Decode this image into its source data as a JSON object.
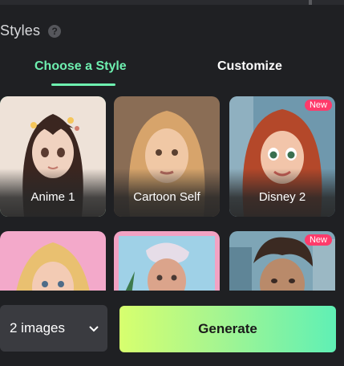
{
  "header": {
    "title": "Styles",
    "help_icon": "?"
  },
  "tabs": [
    {
      "label": "Choose a Style",
      "active": true
    },
    {
      "label": "Customize",
      "active": false
    }
  ],
  "styles": [
    {
      "label": "Anime 1",
      "selected": true,
      "badge": "",
      "palette": [
        "#f2e6df",
        "#3b2620",
        "#e9c8b5"
      ]
    },
    {
      "label": "Cartoon Self",
      "selected": false,
      "badge": "",
      "palette": [
        "#b58a64",
        "#d9a46c",
        "#f0c9a6"
      ]
    },
    {
      "label": "Disney 2",
      "selected": false,
      "badge": "New",
      "palette": [
        "#6b9bb3",
        "#b24a2b",
        "#f1c3a8"
      ]
    },
    {
      "label": "",
      "selected": false,
      "badge": "",
      "palette": [
        "#f0a8c8",
        "#e9c070",
        "#f1c9b0"
      ]
    },
    {
      "label": "",
      "selected": false,
      "badge": "",
      "palette": [
        "#f3a3c3",
        "#e6dde8",
        "#d9a08a"
      ]
    },
    {
      "label": "",
      "selected": false,
      "badge": "New",
      "palette": [
        "#6f97a8",
        "#3b2a22",
        "#b98b6c"
      ]
    }
  ],
  "controls": {
    "image_count": "2 images",
    "generate_label": "Generate"
  },
  "colors": {
    "accent": "#6ef0b0",
    "badge": "#ff3b6b",
    "background": "#1f2023"
  }
}
